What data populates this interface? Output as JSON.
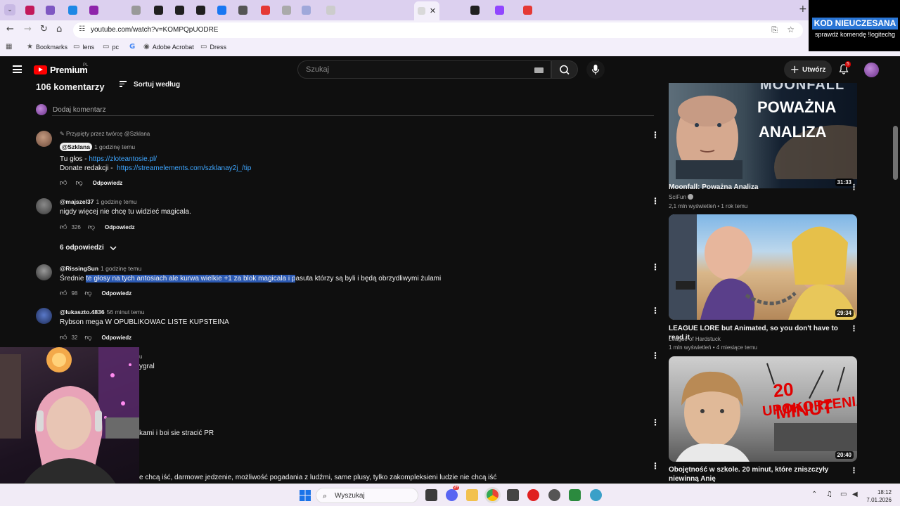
{
  "browser": {
    "url": "youtube.com/watch?v=KOMPQpUODRE",
    "bookmarks": [
      {
        "label": "Bookmarks",
        "icon": "star-icon"
      },
      {
        "label": "lens",
        "icon": "folder-icon"
      },
      {
        "label": "pc",
        "icon": "folder-icon"
      },
      {
        "label": "",
        "icon": "google-icon"
      },
      {
        "label": "Adobe Acrobat",
        "icon": "acrobat-icon"
      },
      {
        "label": "Dress",
        "icon": "folder-icon"
      }
    ],
    "tab_colors": [
      "#c2185b",
      "#7e57c2",
      "#1e88e5",
      "#8e24aa",
      "#999999",
      "#202020",
      "#202020",
      "#202020",
      "#1877f2",
      "#555555",
      "#e53935",
      "#aaaaaa",
      "#9fa8da",
      "#cccccc",
      "#202020",
      "#9146ff",
      "#e53935"
    ]
  },
  "promo": {
    "title": "KOD NIEUCZESANA",
    "subtitle": "sprawdź komendę !logitechg"
  },
  "header": {
    "brand": "Premium",
    "region": "PL",
    "search_placeholder": "Szukaj",
    "create_label": "Utwórz",
    "notif_count": "5"
  },
  "comments_section": {
    "count_title": "106 komentarzy",
    "sort_label": "Sortuj według",
    "add_placeholder": "Dodaj komentarz",
    "reply_label": "Odpowiedz",
    "replies_toggle": "6 odpowiedzi",
    "pinned_label": "Przypięty przez twórcę @Szklana",
    "comments": [
      {
        "author": "@Szklana",
        "time": "1 godzinę temu",
        "line1_prefix": "Tu głos - ",
        "line1_link": "https://zloteantosie.pl/",
        "line2_prefix": "Donate redakcji -  ",
        "line2_link": "https://streamelements.com/szklanay2j_/tip",
        "likes": ""
      },
      {
        "author": "@majszel37",
        "time": "1 godzinę temu",
        "text": "nigdy więcej nie chcę tu widzieć magicala.",
        "likes": "326"
      },
      {
        "author": "@RissingSun",
        "time": "1 godzinę temu",
        "text_pre": "Średnie ",
        "text_selected": "te głosy na tych antosiach ale kurwa wielkie +1 za blok magicala i p",
        "text_post": "asuta którzy są byli i będą obrzydliwymi żulami",
        "likes": "98"
      },
      {
        "author": "@lukaszto.4836",
        "time": "56 minut temu",
        "text": "Rybson mega W OPUBLIKOWAC LISTE KUPSTEINA",
        "likes": "32"
      }
    ],
    "partial": [
      {
        "text": "u"
      },
      {
        "text": "ygral"
      },
      {
        "text": "kami i boi sie stracić PR"
      },
      {
        "text": "e chcą iść, darmowe jedzenie, możliwość pogadania z ludźmi, same plusy, tylko zakompleksieni ludzie nie chcą iść"
      }
    ]
  },
  "sidebar": {
    "videos": [
      {
        "title": "Moonfall: Poważna Analiza",
        "channel": "SciFun",
        "meta": "2,1 mln wyświetleń • 1 rok temu",
        "duration": "31:33",
        "thumb_text1": "MOONFALL",
        "thumb_text2": "POWAŻNA",
        "thumb_text3": "ANALIZA"
      },
      {
        "title": "LEAGUE LORE but Animated, so you don't have to read it",
        "channel": "League of Hardstuck",
        "meta": "1 mln wyświetleń • 4 miesiące temu",
        "duration": "29:34"
      },
      {
        "title": "Obojętność w szkole. 20 minut, które zniszczyły niewinną Anię",
        "channel": "",
        "meta": "",
        "duration": "20:40",
        "thumb_text1": "20 MINUT",
        "thumb_text2": "UPOKORZENIA"
      }
    ]
  },
  "taskbar": {
    "search_placeholder": "Wyszukaj",
    "time": "18:12",
    "date": "7.01.2026",
    "discord_badge": "9+"
  }
}
